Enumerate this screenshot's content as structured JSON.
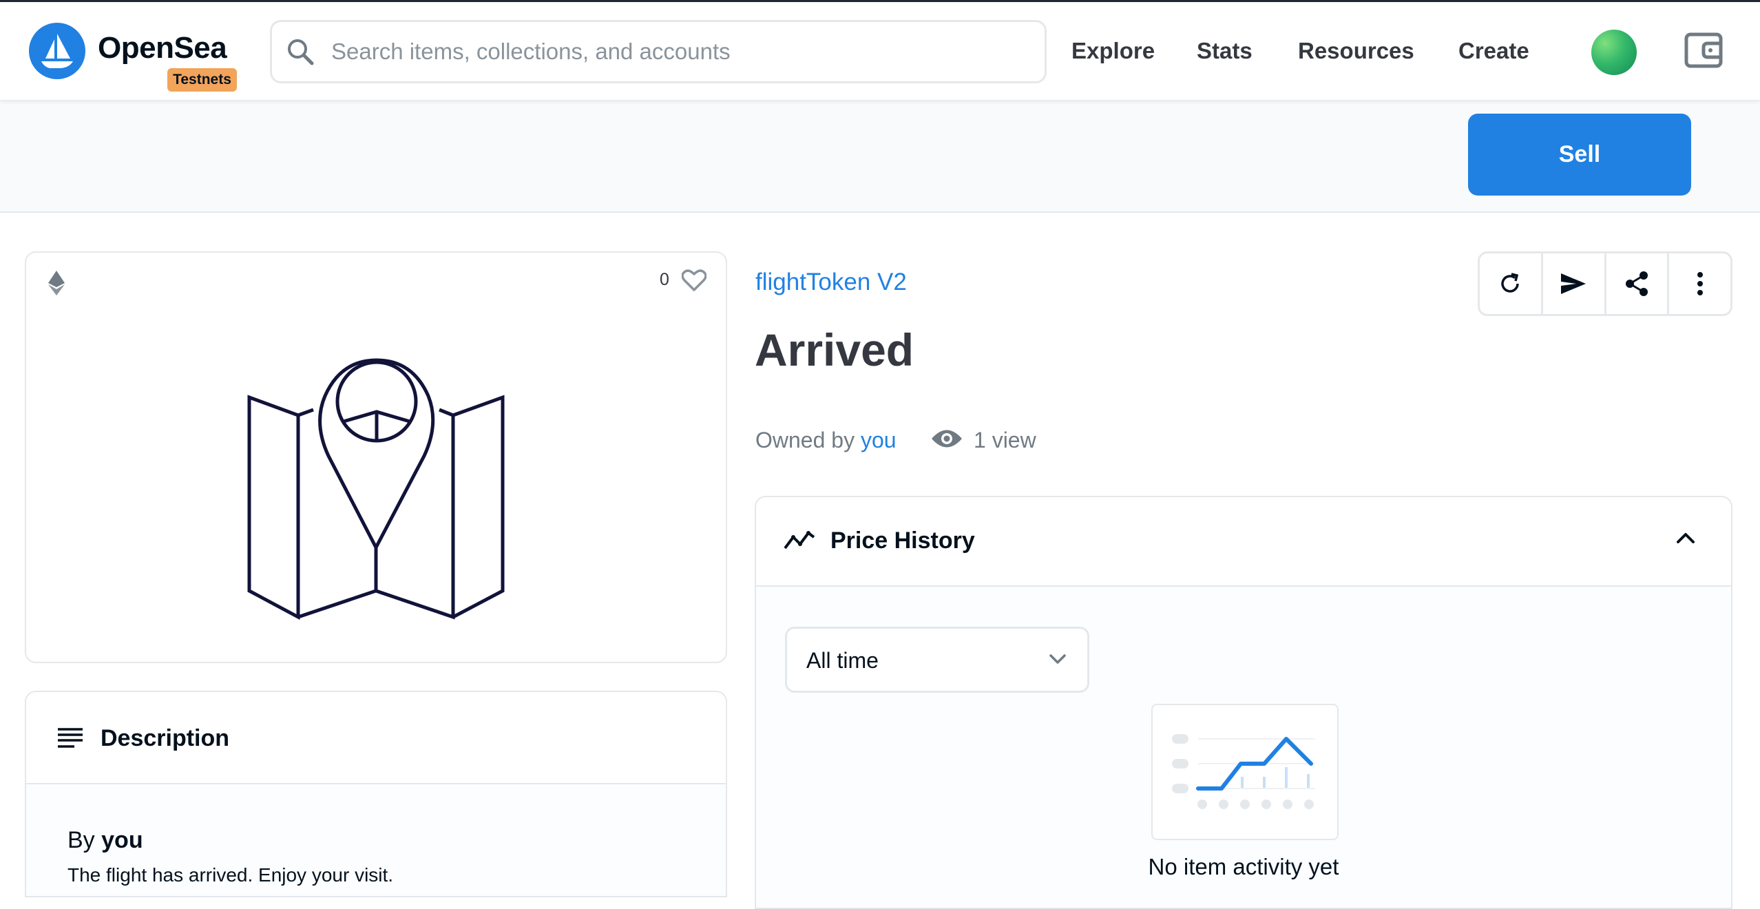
{
  "brand": {
    "name": "OpenSea",
    "badge": "Testnets"
  },
  "search": {
    "placeholder": "Search items, collections, and accounts"
  },
  "nav": [
    "Explore",
    "Stats",
    "Resources",
    "Create"
  ],
  "sell_label": "Sell",
  "item": {
    "favorites": "0",
    "collection": "flightToken V2",
    "title": "Arrived",
    "owned_by_label": "Owned by",
    "owner": "you",
    "views": "1 view"
  },
  "description": {
    "title": "Description",
    "by_label": "By",
    "by_value": "you",
    "text": "The flight has arrived. Enjoy your visit."
  },
  "price_history": {
    "title": "Price History",
    "range": "All time",
    "empty": "No item activity yet"
  },
  "colors": {
    "accent": "#2081e2",
    "badge": "#f2a45b",
    "text": "#04111d",
    "muted": "#707a83",
    "border": "#e5e8eb"
  },
  "icons": [
    "opensea-logo-icon",
    "search-icon",
    "avatar",
    "wallet-icon",
    "ethereum-icon",
    "heart-icon",
    "refresh-icon",
    "send-icon",
    "share-icon",
    "more-icon",
    "eye-icon",
    "description-icon",
    "trend-icon",
    "chevron-up-icon",
    "chevron-down-icon"
  ]
}
